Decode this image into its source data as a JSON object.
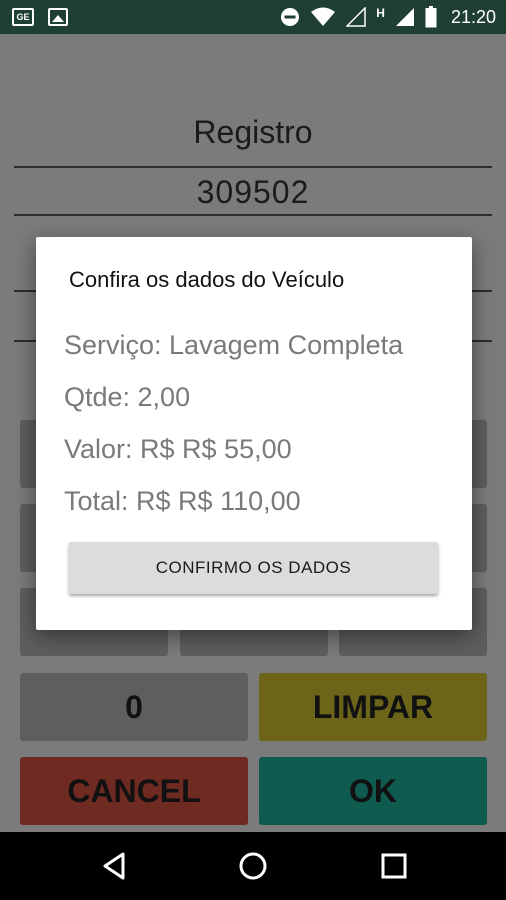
{
  "status_bar": {
    "notif_1": "GE",
    "net_label": "H",
    "time": "21:20"
  },
  "background": {
    "registro_label": "Registro",
    "registro_value": "309502",
    "keys": {
      "zero": "0",
      "limpar": "LIMPAR",
      "cancel": "CANCEL",
      "ok": "OK"
    }
  },
  "dialog": {
    "title": "Confira os dados do Veículo",
    "servico": "Serviço: Lavagem Completa",
    "qtde": "Qtde: 2,00",
    "valor": "Valor: R$ R$ 55,00",
    "total": "Total: R$ R$ 110,00",
    "confirm_button": "CONFIRMO OS DADOS"
  },
  "colors": {
    "status_bar": "#1f3f33",
    "dialog_bg": "#ffffff",
    "button_bg": "#dcdcdc"
  },
  "icons": [
    "notification-ge-icon",
    "image-notification-icon",
    "do-not-disturb-icon",
    "wifi-icon",
    "signal-empty-icon",
    "signal-icon",
    "battery-icon",
    "back-icon",
    "home-icon",
    "recents-icon"
  ]
}
